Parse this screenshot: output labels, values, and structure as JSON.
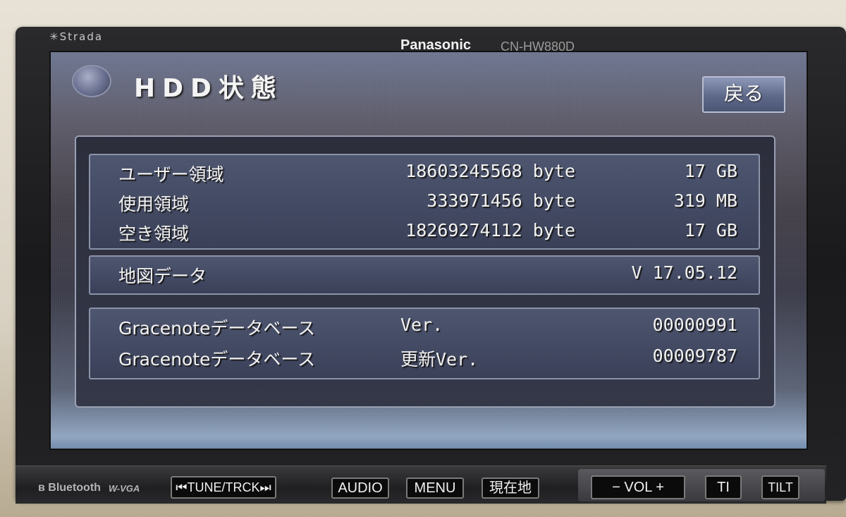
{
  "device": {
    "series_logo": "✳Strada",
    "brand": "Panasonic",
    "model": "CN-HW880D"
  },
  "screen": {
    "title": "HDD状態",
    "back_button": "戻る",
    "storage": [
      {
        "label": "ユーザー領域",
        "bytes": "18603245568 byte",
        "size": "17 GB"
      },
      {
        "label": "使用領域",
        "bytes": "333971456 byte",
        "size": "319 MB"
      },
      {
        "label": "空き領域",
        "bytes": "18269274112 byte",
        "size": "17 GB"
      }
    ],
    "map_data": {
      "label": "地図データ",
      "version": "V 17.05.12"
    },
    "gracenote": [
      {
        "label": "Gracenoteデータベース",
        "version_label": "Ver.",
        "value": "00000991"
      },
      {
        "label": "Gracenoteデータベース",
        "version_label": "更新Ver.",
        "value": "00009787"
      }
    ]
  },
  "controls": {
    "bluetooth": "Bluetooth",
    "wvga": "W-VGA",
    "tune_track": "⏮TUNE/TRCK⏭",
    "audio": "AUDIO",
    "menu": "MENU",
    "current_location": "現在地",
    "volume": "−  VOL  +",
    "ti": "TI",
    "tilt": "TILT"
  }
}
